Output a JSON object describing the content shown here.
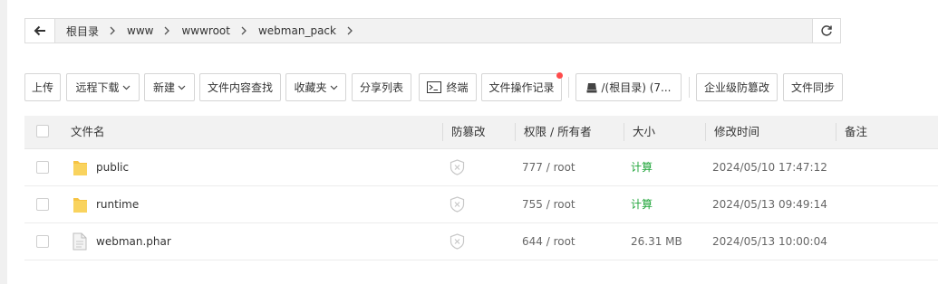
{
  "path": {
    "crumbs": [
      "根目录",
      "www",
      "wwwroot",
      "webman_pack"
    ]
  },
  "toolbar": {
    "upload": "上传",
    "remote_download": "远程下载",
    "new": "新建",
    "content_search": "文件内容查找",
    "favorites": "收藏夹",
    "share_list": "分享列表",
    "terminal": "终端",
    "operation_log": "文件操作记录",
    "disk": "/(根目录) (7...",
    "tamper_protect": "企业级防篡改",
    "file_sync": "文件同步"
  },
  "table": {
    "headers": {
      "name": "文件名",
      "tamper": "防篡改",
      "perm": "权限 / 所有者",
      "size": "大小",
      "mtime": "修改时间",
      "note": "备注"
    },
    "rows": [
      {
        "name": "public",
        "type": "folder",
        "perm": "777 / root",
        "size": "计算",
        "mtime": "2024/05/10 17:47:12"
      },
      {
        "name": "runtime",
        "type": "folder",
        "perm": "755 / root",
        "size": "计算",
        "mtime": "2024/05/13 09:49:14"
      },
      {
        "name": "webman.phar",
        "type": "file",
        "perm": "644 / root",
        "size": "26.31 MB",
        "mtime": "2024/05/13 10:00:04"
      }
    ]
  },
  "colors": {
    "accent_green": "#20a53a",
    "notify_red": "#ff4b4b",
    "folder_yellow": "#f6c343"
  }
}
